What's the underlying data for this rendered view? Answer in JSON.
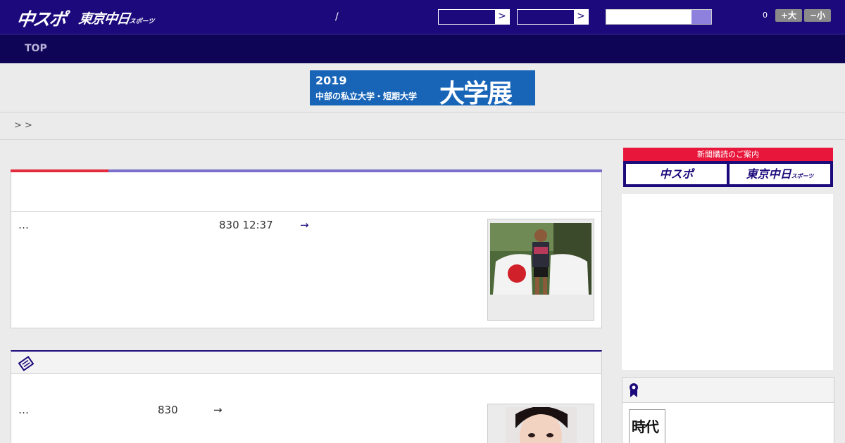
{
  "header": {
    "logo_primary": "中スポ",
    "logo_secondary": "東京中日",
    "logo_secondary_small": "スポーツ",
    "separator": "/",
    "select_arrow": ">",
    "font_size_value": "0",
    "font_larger": "+大",
    "font_smaller": "−小"
  },
  "nav": {
    "top_label": "TOP"
  },
  "banner": {
    "year": "2019",
    "subtitle": "中部の私立大学・短期大学",
    "title": "大学展",
    "bg_color": "#1865b8"
  },
  "breadcrumb": {
    "text": "> >"
  },
  "article_1": {
    "ellipsis": "…",
    "date": "830 12:37",
    "arrow": "→"
  },
  "article_2": {
    "ellipsis": "…",
    "date": "830",
    "arrow": "→"
  },
  "sidebar": {
    "promo_title": "新聞購読のご案内",
    "promo_left": "中スポ",
    "promo_right": "東京中日",
    "promo_right_small": "スポーツ",
    "book_title": "時代"
  },
  "colors": {
    "header": "#1c0a7c",
    "nav": "#0f0557",
    "accent_red": "#e22b3b",
    "accent_purple": "#7a6fc9",
    "promo_red": "#e8163a"
  },
  "icons": {
    "search_button": "search-button-icon",
    "newspaper": "newspaper-icon",
    "ribbon": "ribbon-icon",
    "chevron": "chevron-right-icon"
  }
}
